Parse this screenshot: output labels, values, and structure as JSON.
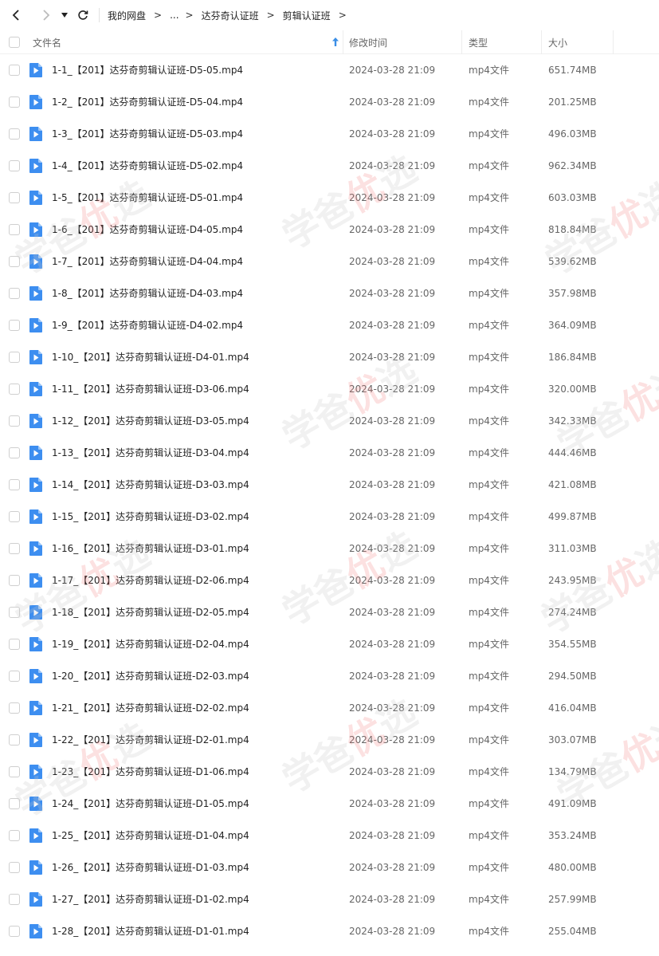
{
  "breadcrumb": [
    "我的网盘",
    "...",
    "达芬奇认证班",
    "剪辑认证班"
  ],
  "columns": {
    "name": "文件名",
    "date": "修改时间",
    "type": "类型",
    "size": "大小"
  },
  "watermark": {
    "text_a": "学爸",
    "text_b": "优",
    "text_c": "选"
  },
  "files": [
    {
      "name": "1-1_【201】达芬奇剪辑认证班-D5-05.mp4",
      "date": "2024-03-28 21:09",
      "type": "mp4文件",
      "size": "651.74MB"
    },
    {
      "name": "1-2_【201】达芬奇剪辑认证班-D5-04.mp4",
      "date": "2024-03-28 21:09",
      "type": "mp4文件",
      "size": "201.25MB"
    },
    {
      "name": "1-3_【201】达芬奇剪辑认证班-D5-03.mp4",
      "date": "2024-03-28 21:09",
      "type": "mp4文件",
      "size": "496.03MB"
    },
    {
      "name": "1-4_【201】达芬奇剪辑认证班-D5-02.mp4",
      "date": "2024-03-28 21:09",
      "type": "mp4文件",
      "size": "962.34MB"
    },
    {
      "name": "1-5_【201】达芬奇剪辑认证班-D5-01.mp4",
      "date": "2024-03-28 21:09",
      "type": "mp4文件",
      "size": "603.03MB"
    },
    {
      "name": "1-6_【201】达芬奇剪辑认证班-D4-05.mp4",
      "date": "2024-03-28 21:09",
      "type": "mp4文件",
      "size": "818.84MB"
    },
    {
      "name": "1-7_【201】达芬奇剪辑认证班-D4-04.mp4",
      "date": "2024-03-28 21:09",
      "type": "mp4文件",
      "size": "539.62MB"
    },
    {
      "name": "1-8_【201】达芬奇剪辑认证班-D4-03.mp4",
      "date": "2024-03-28 21:09",
      "type": "mp4文件",
      "size": "357.98MB"
    },
    {
      "name": "1-9_【201】达芬奇剪辑认证班-D4-02.mp4",
      "date": "2024-03-28 21:09",
      "type": "mp4文件",
      "size": "364.09MB"
    },
    {
      "name": "1-10_【201】达芬奇剪辑认证班-D4-01.mp4",
      "date": "2024-03-28 21:09",
      "type": "mp4文件",
      "size": "186.84MB"
    },
    {
      "name": "1-11_【201】达芬奇剪辑认证班-D3-06.mp4",
      "date": "2024-03-28 21:09",
      "type": "mp4文件",
      "size": "320.00MB"
    },
    {
      "name": "1-12_【201】达芬奇剪辑认证班-D3-05.mp4",
      "date": "2024-03-28 21:09",
      "type": "mp4文件",
      "size": "342.33MB"
    },
    {
      "name": "1-13_【201】达芬奇剪辑认证班-D3-04.mp4",
      "date": "2024-03-28 21:09",
      "type": "mp4文件",
      "size": "444.46MB"
    },
    {
      "name": "1-14_【201】达芬奇剪辑认证班-D3-03.mp4",
      "date": "2024-03-28 21:09",
      "type": "mp4文件",
      "size": "421.08MB"
    },
    {
      "name": "1-15_【201】达芬奇剪辑认证班-D3-02.mp4",
      "date": "2024-03-28 21:09",
      "type": "mp4文件",
      "size": "499.87MB"
    },
    {
      "name": "1-16_【201】达芬奇剪辑认证班-D3-01.mp4",
      "date": "2024-03-28 21:09",
      "type": "mp4文件",
      "size": "311.03MB"
    },
    {
      "name": "1-17_【201】达芬奇剪辑认证班-D2-06.mp4",
      "date": "2024-03-28 21:09",
      "type": "mp4文件",
      "size": "243.95MB"
    },
    {
      "name": "1-18_【201】达芬奇剪辑认证班-D2-05.mp4",
      "date": "2024-03-28 21:09",
      "type": "mp4文件",
      "size": "274.24MB"
    },
    {
      "name": "1-19_【201】达芬奇剪辑认证班-D2-04.mp4",
      "date": "2024-03-28 21:09",
      "type": "mp4文件",
      "size": "354.55MB"
    },
    {
      "name": "1-20_【201】达芬奇剪辑认证班-D2-03.mp4",
      "date": "2024-03-28 21:09",
      "type": "mp4文件",
      "size": "294.50MB"
    },
    {
      "name": "1-21_【201】达芬奇剪辑认证班-D2-02.mp4",
      "date": "2024-03-28 21:09",
      "type": "mp4文件",
      "size": "416.04MB"
    },
    {
      "name": "1-22_【201】达芬奇剪辑认证班-D2-01.mp4",
      "date": "2024-03-28 21:09",
      "type": "mp4文件",
      "size": "303.07MB"
    },
    {
      "name": "1-23_【201】达芬奇剪辑认证班-D1-06.mp4",
      "date": "2024-03-28 21:09",
      "type": "mp4文件",
      "size": "134.79MB"
    },
    {
      "name": "1-24_【201】达芬奇剪辑认证班-D1-05.mp4",
      "date": "2024-03-28 21:09",
      "type": "mp4文件",
      "size": "491.09MB"
    },
    {
      "name": "1-25_【201】达芬奇剪辑认证班-D1-04.mp4",
      "date": "2024-03-28 21:09",
      "type": "mp4文件",
      "size": "353.24MB"
    },
    {
      "name": "1-26_【201】达芬奇剪辑认证班-D1-03.mp4",
      "date": "2024-03-28 21:09",
      "type": "mp4文件",
      "size": "480.00MB"
    },
    {
      "name": "1-27_【201】达芬奇剪辑认证班-D1-02.mp4",
      "date": "2024-03-28 21:09",
      "type": "mp4文件",
      "size": "257.99MB"
    },
    {
      "name": "1-28_【201】达芬奇剪辑认证班-D1-01.mp4",
      "date": "2024-03-28 21:09",
      "type": "mp4文件",
      "size": "255.04MB"
    }
  ],
  "colors": {
    "accent": "#3a8ee6",
    "icon_blue": "#3d8ef0",
    "text": "#222222",
    "muted": "#666666"
  }
}
